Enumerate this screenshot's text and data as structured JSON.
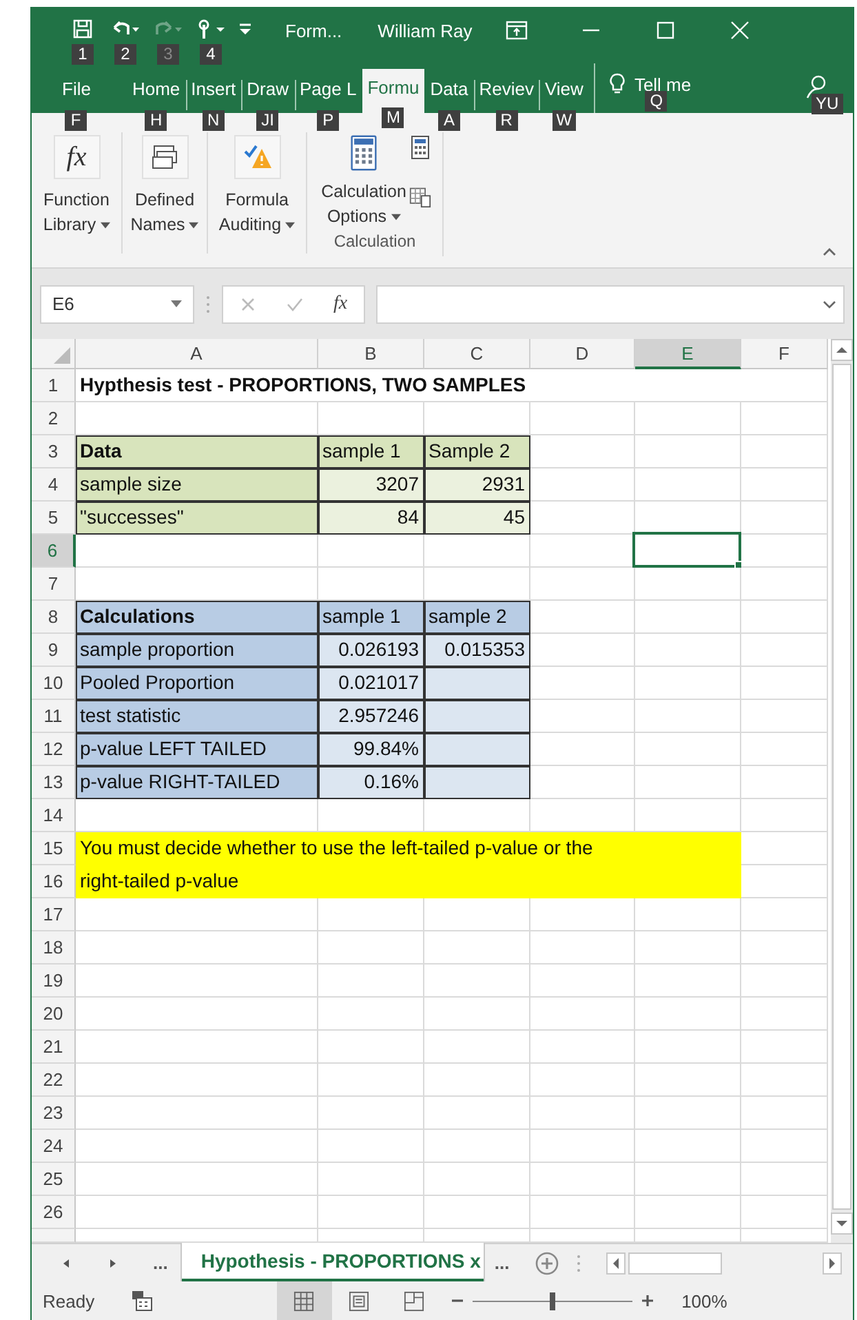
{
  "title_bar": {
    "quick_access": [
      {
        "kind": "save",
        "keytip": "1",
        "disabled": false
      },
      {
        "kind": "undo",
        "keytip": "2",
        "disabled": false
      },
      {
        "kind": "redo",
        "keytip": "3",
        "disabled": true
      },
      {
        "kind": "touch",
        "keytip": "4",
        "disabled": false
      },
      {
        "kind": "customize"
      }
    ],
    "document": "Form...",
    "user": "William Ray",
    "controls": [
      {
        "kind": "ribbon-options"
      },
      {
        "kind": "minimize"
      },
      {
        "kind": "maximize"
      },
      {
        "kind": "close"
      }
    ]
  },
  "tabs": [
    {
      "label": "File",
      "keytip": "F",
      "selected": false
    },
    {
      "label": "Home",
      "keytip": "H",
      "selected": false
    },
    {
      "label": "Insert",
      "keytip": "N",
      "selected": false
    },
    {
      "label": "Draw",
      "keytip": "JI",
      "selected": false
    },
    {
      "label": "Page L",
      "keytip": "P",
      "selected": false
    },
    {
      "label": "Formu",
      "keytip": "M",
      "selected": true
    },
    {
      "label": "Data",
      "keytip": "A",
      "selected": false
    },
    {
      "label": "Reviev",
      "keytip": "R",
      "selected": false
    },
    {
      "label": "View",
      "keytip": "W",
      "selected": false
    }
  ],
  "tell_me": {
    "label": "Tell me",
    "keytip": "Q"
  },
  "account": {
    "keytip": "YU"
  },
  "ribbon": {
    "buttons": [
      {
        "kind": "function-library",
        "icon_text": "fx",
        "label": "Function Library",
        "dropdown": true
      },
      {
        "kind": "defined-names",
        "label": "Defined Names",
        "dropdown": true
      },
      {
        "kind": "formula-auditing",
        "label": "Formula Auditing",
        "dropdown": true
      }
    ],
    "calculation": {
      "label": "Calculation",
      "button": {
        "label": "Calculation Options",
        "dropdown": true
      }
    }
  },
  "formula_bar": {
    "name_box": "E6",
    "function_symbol": "fx"
  },
  "sheet": {
    "columns": [
      {
        "label": "A",
        "selected": false
      },
      {
        "label": "B",
        "selected": false
      },
      {
        "label": "C",
        "selected": false
      },
      {
        "label": "D",
        "selected": false
      },
      {
        "label": "E",
        "selected": true
      },
      {
        "label": "F",
        "selected": false
      }
    ],
    "rows": [
      {
        "number": "1",
        "selected": false,
        "cells": [
          {
            "text": "Hypthesis test - PROPORTIONS, TWO SAMPLES",
            "kind": "text",
            "bold": true,
            "border": false
          }
        ]
      },
      {
        "number": "2",
        "selected": false
      },
      {
        "number": "3",
        "selected": false,
        "cells": [
          {
            "text": "Data",
            "kind": "text",
            "bold": true,
            "color": "#d8e4bc",
            "border": true
          },
          {
            "text": "sample 1",
            "kind": "text",
            "bold": false,
            "color": "#d8e4bc",
            "border": true
          },
          {
            "text": "Sample 2",
            "kind": "text",
            "bold": false,
            "color": "#d8e4bc",
            "border": true
          }
        ]
      },
      {
        "number": "4",
        "selected": false,
        "cells": [
          {
            "text": "sample size",
            "kind": "text",
            "bold": false,
            "color": "#d8e4bc",
            "border": true
          },
          {
            "text": "3207",
            "kind": "number",
            "bold": false,
            "color": "#ebf1de",
            "border": true
          },
          {
            "text": "2931",
            "kind": "number",
            "bold": false,
            "color": "#ebf1de",
            "border": true
          }
        ]
      },
      {
        "number": "5",
        "selected": false,
        "cells": [
          {
            "text": "\"successes\"",
            "kind": "text",
            "bold": false,
            "color": "#d8e4bc",
            "border": true
          },
          {
            "text": "84",
            "kind": "number",
            "bold": false,
            "color": "#ebf1de",
            "border": true
          },
          {
            "text": "45",
            "kind": "number",
            "bold": false,
            "color": "#ebf1de",
            "border": true
          }
        ]
      },
      {
        "number": "6",
        "selected": true
      },
      {
        "number": "7",
        "selected": false
      },
      {
        "number": "8",
        "selected": false,
        "cells": [
          {
            "text": "Calculations",
            "kind": "text",
            "bold": true,
            "color": "#b8cce4",
            "border": true
          },
          {
            "text": "sample 1",
            "kind": "text",
            "bold": false,
            "color": "#b8cce4",
            "border": true
          },
          {
            "text": "sample 2",
            "kind": "text",
            "bold": false,
            "color": "#b8cce4",
            "border": true
          }
        ]
      },
      {
        "number": "9",
        "selected": false,
        "cells": [
          {
            "text": "sample proportion",
            "kind": "text",
            "bold": false,
            "color": "#b8cce4",
            "border": true
          },
          {
            "text": "0.026193",
            "kind": "number",
            "bold": false,
            "color": "#dce6f1",
            "border": true
          },
          {
            "text": "0.015353",
            "kind": "number",
            "bold": false,
            "color": "#dce6f1",
            "border": true
          }
        ]
      },
      {
        "number": "10",
        "selected": false,
        "cells": [
          {
            "text": "Pooled Proportion",
            "kind": "text",
            "bold": false,
            "color": "#b8cce4",
            "border": true
          },
          {
            "text": "0.021017",
            "kind": "number",
            "bold": false,
            "color": "#dce6f1",
            "border": true
          },
          {
            "color": "#dce6f1",
            "border": true
          }
        ]
      },
      {
        "number": "11",
        "selected": false,
        "cells": [
          {
            "text": "test statistic",
            "kind": "text",
            "bold": false,
            "color": "#b8cce4",
            "border": true
          },
          {
            "text": "2.957246",
            "kind": "number",
            "bold": false,
            "color": "#dce6f1",
            "border": true
          },
          {
            "color": "#dce6f1",
            "border": true
          }
        ]
      },
      {
        "number": "12",
        "selected": false,
        "cells": [
          {
            "text": "p-value LEFT TAILED",
            "kind": "text",
            "bold": false,
            "color": "#b8cce4",
            "border": true
          },
          {
            "text": "99.84%",
            "kind": "number",
            "bold": false,
            "color": "#dce6f1",
            "border": true
          },
          {
            "color": "#dce6f1",
            "border": true
          }
        ]
      },
      {
        "number": "13",
        "selected": false,
        "cells": [
          {
            "text": "p-value RIGHT-TAILED",
            "kind": "text",
            "bold": false,
            "color": "#b8cce4",
            "border": true
          },
          {
            "text": "0.16%",
            "kind": "number",
            "bold": false,
            "color": "#dce6f1",
            "border": true
          },
          {
            "color": "#dce6f1",
            "border": true
          }
        ]
      },
      {
        "number": "14",
        "selected": false
      },
      {
        "number": "15",
        "selected": false,
        "cells": [
          {
            "text": "You must decide whether to use the left-tailed p-value or the",
            "kind": "text",
            "bold": false,
            "color": "#ffff00",
            "border": false
          },
          {
            "color": "#ffff00",
            "border": false
          },
          {
            "color": "#ffff00",
            "border": false
          },
          {
            "color": "#ffff00",
            "border": false
          },
          {
            "color": "#ffff00",
            "border": false
          }
        ]
      },
      {
        "number": "16",
        "selected": false,
        "cells": [
          {
            "text": "right-tailed p-value",
            "kind": "text",
            "bold": false,
            "color": "#ffff00",
            "border": false
          },
          {
            "color": "#ffff00",
            "border": false
          },
          {
            "color": "#ffff00",
            "border": false
          },
          {
            "color": "#ffff00",
            "border": false
          },
          {
            "color": "#ffff00",
            "border": false
          }
        ]
      },
      {
        "number": "17",
        "selected": false
      },
      {
        "number": "18",
        "selected": false
      },
      {
        "number": "19",
        "selected": false
      },
      {
        "number": "20",
        "selected": false
      },
      {
        "number": "21",
        "selected": false
      },
      {
        "number": "22",
        "selected": false
      },
      {
        "number": "23",
        "selected": false
      },
      {
        "number": "24",
        "selected": false
      },
      {
        "number": "25",
        "selected": false
      },
      {
        "number": "26",
        "selected": false
      }
    ]
  },
  "sheet_tabs": {
    "more_left": "...",
    "tabs": [
      {
        "label": "Hypothesis - PROPORTIONS x",
        "selected": true
      }
    ],
    "more_right": "..."
  },
  "status_bar": {
    "status": "Ready",
    "views": [
      {
        "kind": "normal",
        "selected": true
      },
      {
        "kind": "page-layout",
        "selected": false
      },
      {
        "kind": "page-break",
        "selected": false
      }
    ],
    "zoom": {
      "level": 0.5,
      "reading": "100%"
    }
  }
}
